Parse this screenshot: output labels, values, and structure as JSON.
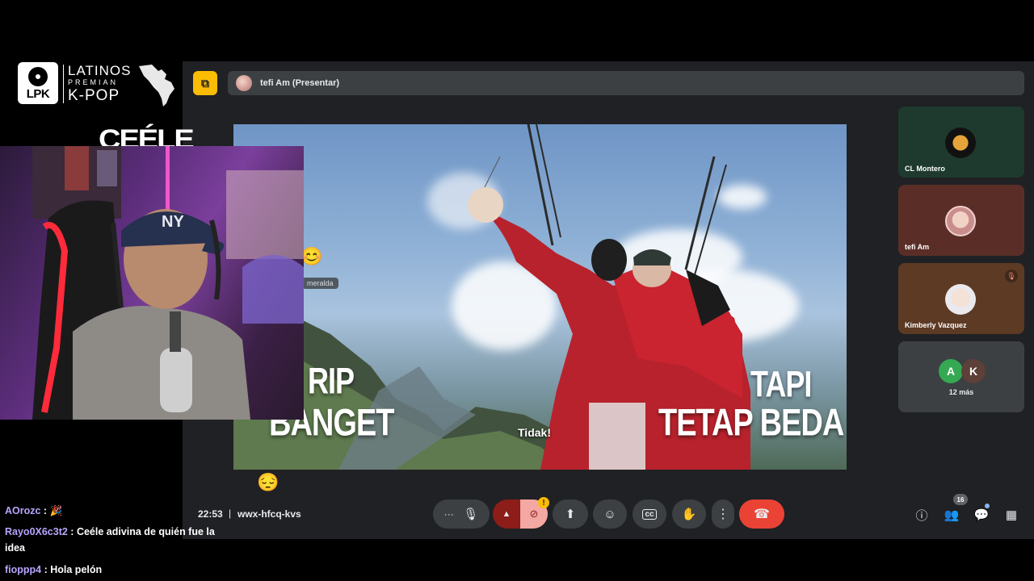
{
  "overlay": {
    "logo_abbr": "LPK",
    "logo_line1": "LATINOS",
    "logo_line2": "PREMIAN",
    "logo_line3": "K-POP",
    "brand": "CEÉLE"
  },
  "meet": {
    "presenter_label": "tefi Am (Presentar)",
    "time": "22:53",
    "separator": "|",
    "meeting_code": "wwx-hfcq-kvs",
    "people_count": "16",
    "camera_warning": "!",
    "participants": [
      {
        "name": "CL Montero"
      },
      {
        "name": "tefi Am"
      },
      {
        "name": "Kimberly Vazquez"
      }
    ],
    "more": {
      "avatar_a": "A",
      "avatar_k": "K",
      "label": "12 más"
    }
  },
  "video": {
    "text_left_1": "RIP",
    "text_left_2": "BANGET",
    "text_right_1": "TAPI",
    "text_right_2": "TETAP BEDA",
    "subtitle": "Tidak!",
    "name_tag": "meralda"
  },
  "chat": [
    {
      "user": "AOrozc",
      "message": "🎉"
    },
    {
      "user": "Rayo0X6c3t2",
      "message": "Ceéle adivina de quién fue la idea"
    },
    {
      "user": "fioppp4",
      "message": "Hola pelón"
    }
  ],
  "colors": {
    "meet_bg": "#202124",
    "leave_red": "#ea4335",
    "present_yellow": "#fbbc04",
    "chat_user": "#b9a4ff"
  }
}
